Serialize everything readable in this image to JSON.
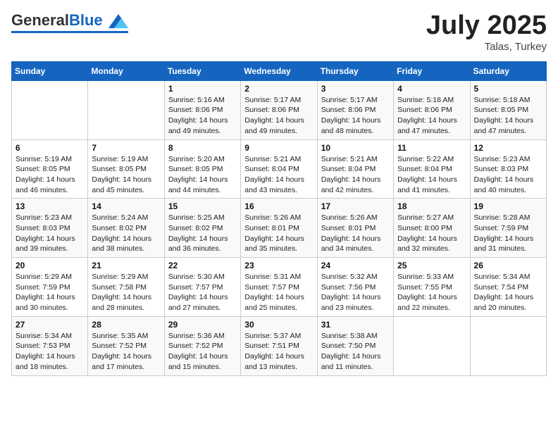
{
  "header": {
    "logo_general": "General",
    "logo_blue": "Blue",
    "month_year": "July 2025",
    "location": "Talas, Turkey"
  },
  "days_of_week": [
    "Sunday",
    "Monday",
    "Tuesday",
    "Wednesday",
    "Thursday",
    "Friday",
    "Saturday"
  ],
  "weeks": [
    [
      {
        "day": "",
        "info": ""
      },
      {
        "day": "",
        "info": ""
      },
      {
        "day": "1",
        "info": "Sunrise: 5:16 AM\nSunset: 8:06 PM\nDaylight: 14 hours and 49 minutes."
      },
      {
        "day": "2",
        "info": "Sunrise: 5:17 AM\nSunset: 8:06 PM\nDaylight: 14 hours and 49 minutes."
      },
      {
        "day": "3",
        "info": "Sunrise: 5:17 AM\nSunset: 8:06 PM\nDaylight: 14 hours and 48 minutes."
      },
      {
        "day": "4",
        "info": "Sunrise: 5:18 AM\nSunset: 8:06 PM\nDaylight: 14 hours and 47 minutes."
      },
      {
        "day": "5",
        "info": "Sunrise: 5:18 AM\nSunset: 8:05 PM\nDaylight: 14 hours and 47 minutes."
      }
    ],
    [
      {
        "day": "6",
        "info": "Sunrise: 5:19 AM\nSunset: 8:05 PM\nDaylight: 14 hours and 46 minutes."
      },
      {
        "day": "7",
        "info": "Sunrise: 5:19 AM\nSunset: 8:05 PM\nDaylight: 14 hours and 45 minutes."
      },
      {
        "day": "8",
        "info": "Sunrise: 5:20 AM\nSunset: 8:05 PM\nDaylight: 14 hours and 44 minutes."
      },
      {
        "day": "9",
        "info": "Sunrise: 5:21 AM\nSunset: 8:04 PM\nDaylight: 14 hours and 43 minutes."
      },
      {
        "day": "10",
        "info": "Sunrise: 5:21 AM\nSunset: 8:04 PM\nDaylight: 14 hours and 42 minutes."
      },
      {
        "day": "11",
        "info": "Sunrise: 5:22 AM\nSunset: 8:04 PM\nDaylight: 14 hours and 41 minutes."
      },
      {
        "day": "12",
        "info": "Sunrise: 5:23 AM\nSunset: 8:03 PM\nDaylight: 14 hours and 40 minutes."
      }
    ],
    [
      {
        "day": "13",
        "info": "Sunrise: 5:23 AM\nSunset: 8:03 PM\nDaylight: 14 hours and 39 minutes."
      },
      {
        "day": "14",
        "info": "Sunrise: 5:24 AM\nSunset: 8:02 PM\nDaylight: 14 hours and 38 minutes."
      },
      {
        "day": "15",
        "info": "Sunrise: 5:25 AM\nSunset: 8:02 PM\nDaylight: 14 hours and 36 minutes."
      },
      {
        "day": "16",
        "info": "Sunrise: 5:26 AM\nSunset: 8:01 PM\nDaylight: 14 hours and 35 minutes."
      },
      {
        "day": "17",
        "info": "Sunrise: 5:26 AM\nSunset: 8:01 PM\nDaylight: 14 hours and 34 minutes."
      },
      {
        "day": "18",
        "info": "Sunrise: 5:27 AM\nSunset: 8:00 PM\nDaylight: 14 hours and 32 minutes."
      },
      {
        "day": "19",
        "info": "Sunrise: 5:28 AM\nSunset: 7:59 PM\nDaylight: 14 hours and 31 minutes."
      }
    ],
    [
      {
        "day": "20",
        "info": "Sunrise: 5:29 AM\nSunset: 7:59 PM\nDaylight: 14 hours and 30 minutes."
      },
      {
        "day": "21",
        "info": "Sunrise: 5:29 AM\nSunset: 7:58 PM\nDaylight: 14 hours and 28 minutes."
      },
      {
        "day": "22",
        "info": "Sunrise: 5:30 AM\nSunset: 7:57 PM\nDaylight: 14 hours and 27 minutes."
      },
      {
        "day": "23",
        "info": "Sunrise: 5:31 AM\nSunset: 7:57 PM\nDaylight: 14 hours and 25 minutes."
      },
      {
        "day": "24",
        "info": "Sunrise: 5:32 AM\nSunset: 7:56 PM\nDaylight: 14 hours and 23 minutes."
      },
      {
        "day": "25",
        "info": "Sunrise: 5:33 AM\nSunset: 7:55 PM\nDaylight: 14 hours and 22 minutes."
      },
      {
        "day": "26",
        "info": "Sunrise: 5:34 AM\nSunset: 7:54 PM\nDaylight: 14 hours and 20 minutes."
      }
    ],
    [
      {
        "day": "27",
        "info": "Sunrise: 5:34 AM\nSunset: 7:53 PM\nDaylight: 14 hours and 18 minutes."
      },
      {
        "day": "28",
        "info": "Sunrise: 5:35 AM\nSunset: 7:52 PM\nDaylight: 14 hours and 17 minutes."
      },
      {
        "day": "29",
        "info": "Sunrise: 5:36 AM\nSunset: 7:52 PM\nDaylight: 14 hours and 15 minutes."
      },
      {
        "day": "30",
        "info": "Sunrise: 5:37 AM\nSunset: 7:51 PM\nDaylight: 14 hours and 13 minutes."
      },
      {
        "day": "31",
        "info": "Sunrise: 5:38 AM\nSunset: 7:50 PM\nDaylight: 14 hours and 11 minutes."
      },
      {
        "day": "",
        "info": ""
      },
      {
        "day": "",
        "info": ""
      }
    ]
  ]
}
